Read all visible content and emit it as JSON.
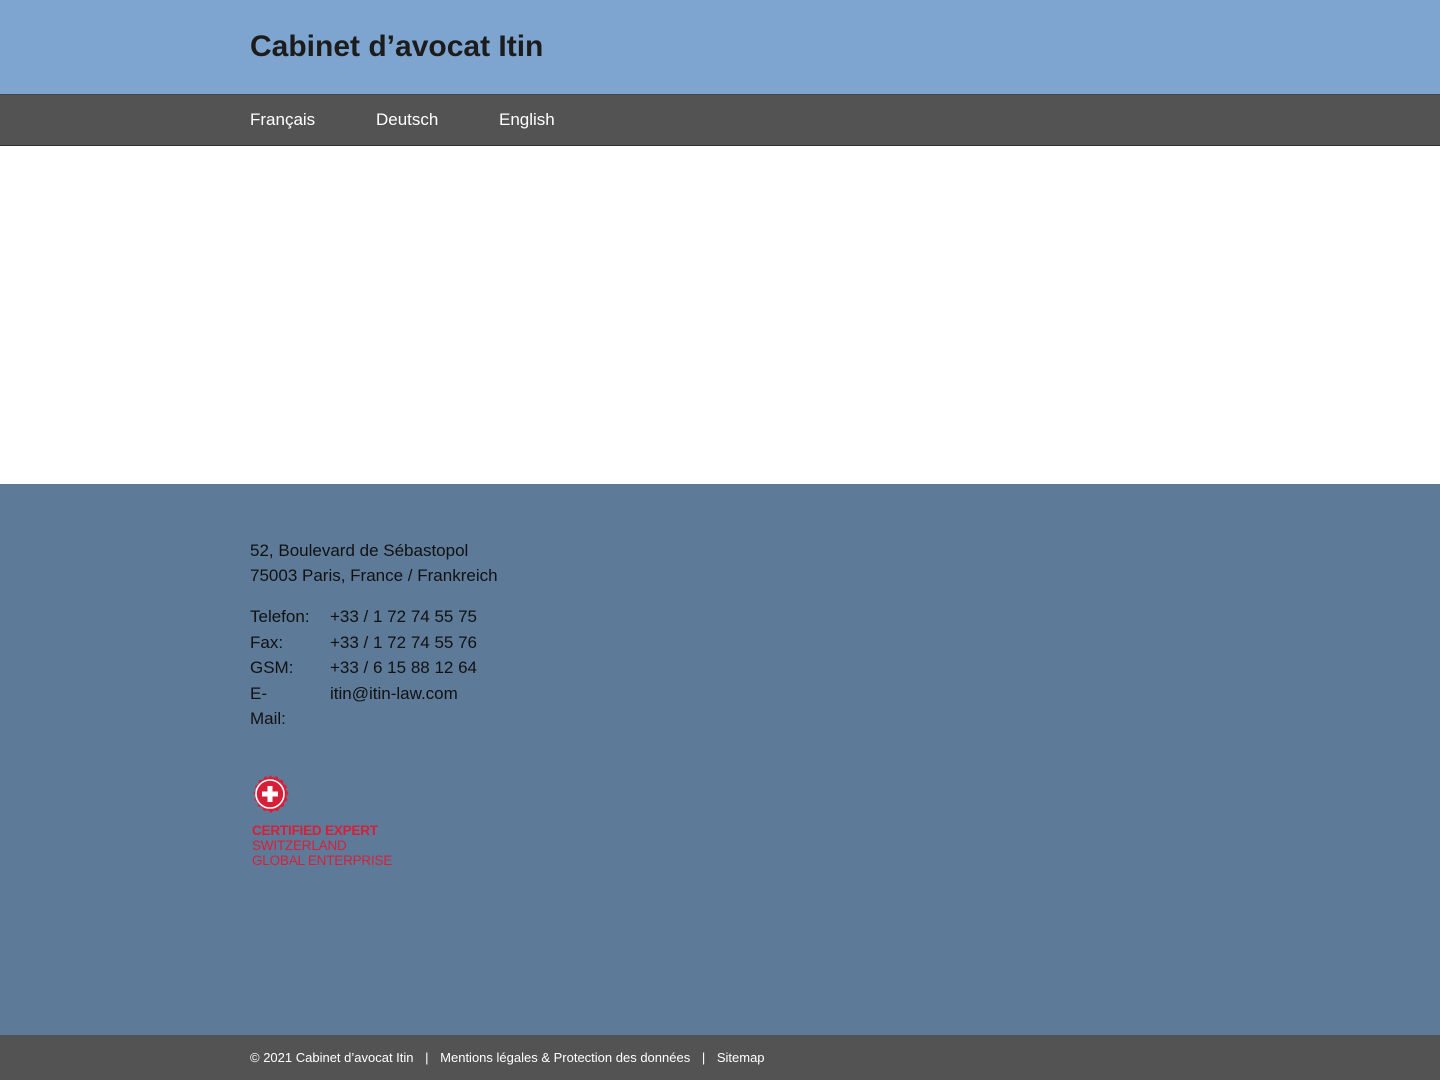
{
  "header": {
    "title": "Cabinet d’avocat Itin"
  },
  "nav": {
    "items": [
      {
        "label": "Français"
      },
      {
        "label": "Deutsch"
      },
      {
        "label": "English"
      }
    ]
  },
  "footer": {
    "address": {
      "line1": "52, Boulevard de Sébastopol",
      "line2": "75003 Paris, France / Frankreich"
    },
    "contacts": [
      {
        "label": "Telefon:",
        "value": "+33 / 1 72 74 55 75"
      },
      {
        "label": "Fax:",
        "value": "+33 / 1 72 74 55 76"
      },
      {
        "label": "GSM:",
        "value": "+33 / 6 15 88 12 64"
      },
      {
        "label": "E-Mail:",
        "value": "itin@itin-law.com"
      }
    ],
    "badge": {
      "icon": "swiss-cross-seal-icon",
      "line1": "CERTIFIED EXPERT",
      "line2": "SWITZERLAND",
      "line3": "GLOBAL ENTERPRISE",
      "color": "#d6203a"
    }
  },
  "bottom_bar": {
    "copyright": "© 2021 Cabinet d’avocat Itin",
    "separator": "|",
    "legal_link": "Mentions légales & Protection des données",
    "sitemap_link": "Sitemap"
  },
  "colors": {
    "header_bg": "#7ea5cf",
    "nav_bg": "#535353",
    "footer_bg": "#5d7b98",
    "accent_red": "#d6203a"
  }
}
